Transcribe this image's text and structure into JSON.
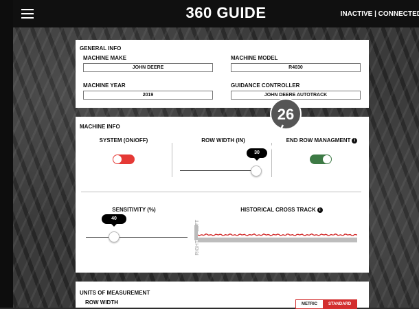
{
  "header": {
    "title": "360 GUIDE",
    "status": "INACTIVE | CONNECTED"
  },
  "general_info": {
    "title": "GENERAL INFO",
    "machine_make_label": "MACHINE MAKE",
    "machine_make_value": "JOHN DEERE",
    "machine_model_label": "MACHINE MODEL",
    "machine_model_value": "R4030",
    "machine_year_label": "MACHINE YEAR",
    "machine_year_value": "2019",
    "guidance_label": "GUIDANCE CONTROLLER",
    "guidance_value": "JOHN DEERE AUTOTRACK"
  },
  "machine_info": {
    "title": "MACHINE INFO",
    "system_label": "SYSTEM (ON/OFF)",
    "system_on": false,
    "row_width_label": "ROW WIDTH (IN)",
    "row_width_value": "30",
    "end_row_label": "END ROW MANAGMENT",
    "end_row_on": true,
    "sensitivity_label": "SENSITIVITY (%)",
    "sensitivity_value": "40",
    "historical_label": "HISTORICAL CROSS TRACK",
    "left_label": "LEFT",
    "right_label": "RIGHT",
    "info_glyph": "i"
  },
  "units": {
    "title": "UNITS OF MEASUREMENT",
    "row_width_label": "ROW WIDTH",
    "metric_label": "METRIC",
    "standard_label": "STANDARD",
    "selected": "STANDARD"
  },
  "step_badge": "26",
  "colors": {
    "toggle_off": "#e53935",
    "toggle_on": "#3d7a45",
    "cross_track": "#d32f2f",
    "accent": "#d32f2f"
  }
}
